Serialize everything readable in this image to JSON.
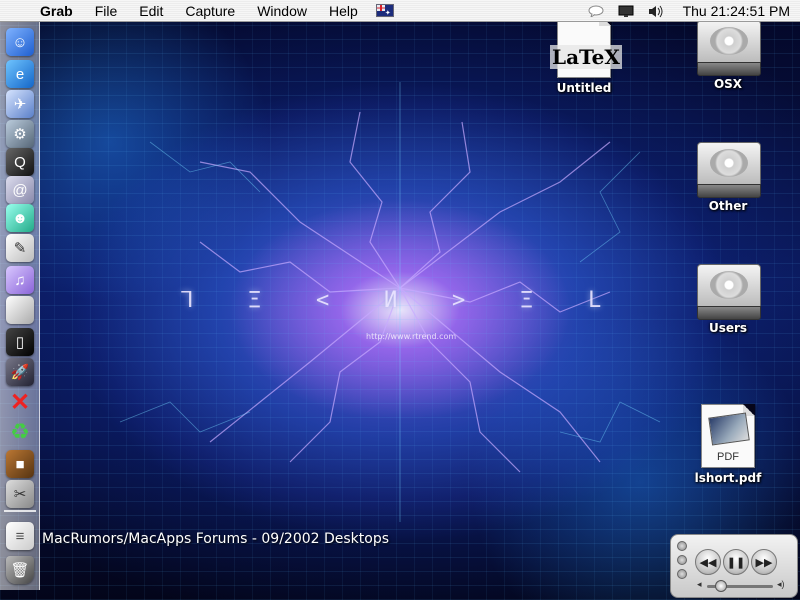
{
  "menubar": {
    "apple_icon": "apple-icon",
    "app_name": "Grab",
    "menus": [
      "File",
      "Edit",
      "Capture",
      "Window",
      "Help"
    ],
    "input_menu_icon": "australian-flag-icon",
    "status_icons": [
      "speech-bubble-icon",
      "display-icon",
      "volume-icon"
    ],
    "clock": "Thu 21:24:51 PM"
  },
  "dock": {
    "items": [
      "finder-icon",
      "internet-explorer-icon",
      "mail-icon",
      "system-preferences-icon",
      "quicktime-icon",
      "address-book-icon",
      "ichat-icon",
      "textedit-icon",
      "itunes-icon",
      "apple-icon",
      "terminal-icon",
      "rocket-icon",
      "x11-icon",
      "recycle-icon",
      "stuffit-icon",
      "grab-icon",
      "notes-icon",
      "trash-icon"
    ]
  },
  "desktop": {
    "wallpaper_glyphs": [
      "ᒣ",
      "Ξ",
      "<",
      "И",
      ">",
      "Ξ",
      "L"
    ],
    "wallpaper_url": "http://www.rtrend.com",
    "caption": "MacRumors/MacApps Forums - 09/2002 Desktops",
    "icons": [
      {
        "label": "Untitled",
        "kind": "latex-document-icon",
        "mark": "LaTeX"
      },
      {
        "label": "OSX",
        "kind": "hard-disk-icon"
      },
      {
        "label": "Other",
        "kind": "hard-disk-icon"
      },
      {
        "label": "Users",
        "kind": "hard-disk-icon"
      },
      {
        "label": "lshort.pdf",
        "kind": "pdf-document-icon",
        "mark": "PDF"
      }
    ]
  },
  "itunes_controller": {
    "buttons": [
      "rewind-icon",
      "pause-icon",
      "fast-forward-icon"
    ],
    "volume_min_icon": "volume-low-icon",
    "volume_max_icon": "volume-high-icon",
    "volume_level": 0.2
  },
  "colors": {
    "menubar_bg": "#efefef",
    "wallpaper_glow": "#9a60ff",
    "wallpaper_cyan": "#2ab4ff",
    "label_text": "#ffffff"
  }
}
